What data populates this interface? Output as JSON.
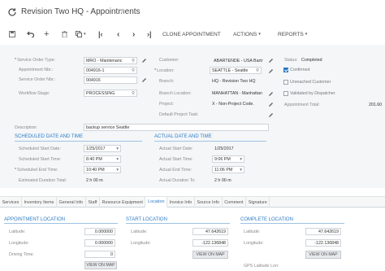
{
  "window": {
    "title": "Revision Two HQ - Appointments"
  },
  "toolbar": {
    "clone_label": "CLONE APPOINTMENT",
    "actions_label": "ACTIONS",
    "reports_label": "REPORTS"
  },
  "header": {
    "service_order_type": {
      "label": "Service Order Type:",
      "value": "MRO - Maintenanc"
    },
    "appointment_nbr": {
      "label": "Appointment Nbr.:",
      "value": "004916-1"
    },
    "service_order_nbr": {
      "label": "Service Order Nbr.:",
      "value": "004916"
    },
    "workflow_stage": {
      "label": "Workflow Stage:",
      "value": "PROCESSING"
    },
    "customer": {
      "label": "Customer:",
      "value": "ABARTENDE - USA Bartr"
    },
    "location": {
      "label": "Location:",
      "value": "SEATTLE - Seattle"
    },
    "branch": {
      "label": "Branch:",
      "value": "HQ - Revision Two HQ"
    },
    "branch_location": {
      "label": "Branch Location:",
      "value": "MANHATTAN - Manhattan"
    },
    "project": {
      "label": "Project:",
      "value": "X - Non-Project Code."
    },
    "default_project_task": {
      "label": "Default Project Task:",
      "value": ""
    },
    "status": {
      "label": "Status:",
      "value": "Completed"
    },
    "confirmed": {
      "label": "Confirmed",
      "checked": true
    },
    "unreached_customer": {
      "label": "Unreached Customer",
      "checked": false
    },
    "validated_by_dispatcher": {
      "label": "Validated by Dispatcher",
      "checked": false
    },
    "appointment_total": {
      "label": "Appointment Total:",
      "value": "201.60"
    },
    "description": {
      "label": "Description:",
      "value": "backup service Seattle"
    }
  },
  "scheduled": {
    "title": "SCHEDULED DATE AND TIME",
    "start_date": {
      "label": "Scheduled Start Date:",
      "value": "1/25/2017"
    },
    "start_time": {
      "label": "Scheduled Start Time:",
      "value": "8:40 PM"
    },
    "end_time": {
      "label": "Scheduled End Time:",
      "value": "10:40 PM"
    },
    "duration": {
      "label": "Estimated Duration Total:",
      "value": "2 h 00 m"
    }
  },
  "actual": {
    "title": "ACTUAL DATE AND TIME",
    "start_date": {
      "label": "Actual Start Date:",
      "value": "1/25/2017"
    },
    "start_time": {
      "label": "Actual Start Time:",
      "value": "9:06 PM"
    },
    "end_time": {
      "label": "Actual End Time:",
      "value": "11:06 PM"
    },
    "duration": {
      "label": "Actual Duration To:",
      "value": "2 h 00 m"
    }
  },
  "tabs": [
    {
      "label": "Services",
      "active": false
    },
    {
      "label": "Inventory Items",
      "active": false
    },
    {
      "label": "General Info",
      "active": false
    },
    {
      "label": "Staff",
      "active": false
    },
    {
      "label": "Resource Equipment",
      "active": false
    },
    {
      "label": "Location",
      "active": true
    },
    {
      "label": "Invoice Info",
      "active": false
    },
    {
      "label": "Source Info",
      "active": false
    },
    {
      "label": "Comment",
      "active": false
    },
    {
      "label": "Signature",
      "active": false
    }
  ],
  "appointment_location": {
    "title": "APPOINTMENT LOCATION",
    "latitude": {
      "label": "Latitude:",
      "value": "0.000000"
    },
    "longitude": {
      "label": "Longitude:",
      "value": "0.000000"
    },
    "driving_time": {
      "label": "Driving Time:",
      "value": "0"
    },
    "view_map": "VIEW ON MAP"
  },
  "start_location": {
    "title": "START LOCATION",
    "latitude": {
      "label": "Latitude:",
      "value": "47.642619"
    },
    "longitude": {
      "label": "Longitude:",
      "value": "-122.136848"
    },
    "view_map": "VIEW ON MAP"
  },
  "complete_location": {
    "title": "COMPLETE LOCATION",
    "latitude": {
      "label": "Latitude:",
      "value": "47.642619"
    },
    "longitude": {
      "label": "Longitude:",
      "value": "-122.136848"
    },
    "view_map": "VIEW ON MAP",
    "gps_latitude": {
      "label": "GPS Latitude Lon:"
    }
  },
  "colors": {
    "accent": "#2f7dc4",
    "header_bg": "#f4f6f8",
    "checkbox_on": "#2b78c5"
  }
}
